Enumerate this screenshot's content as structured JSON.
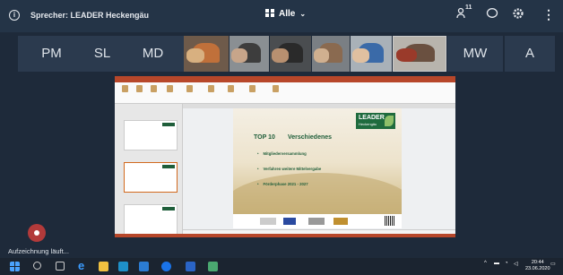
{
  "topbar": {
    "speaker_label": "Sprecher: LEADER Heckengäu",
    "view_label": "Alle",
    "participants_count": "11"
  },
  "participants": {
    "initials": [
      "PM",
      "SL",
      "MD",
      "MW",
      "A"
    ]
  },
  "slide": {
    "logo_line1": "LEADER",
    "logo_line2": "Heckengäu",
    "top_label": "TOP 10",
    "title": "Verschiedenes",
    "bullets": [
      "Mitgliederversammlung",
      "Verfahren weitere Mittelvergabe",
      "Förderphase 2021 - 2027"
    ]
  },
  "recording": {
    "label": "Aufzeichnung läuft..."
  },
  "taskbar": {
    "time": "20:44",
    "date": "23.06.2020"
  },
  "colors": {
    "background": "#1e2a3a",
    "tile": "#2b3a4e",
    "slide_green": "#1f5e3a",
    "record_red": "#b23a3a"
  }
}
